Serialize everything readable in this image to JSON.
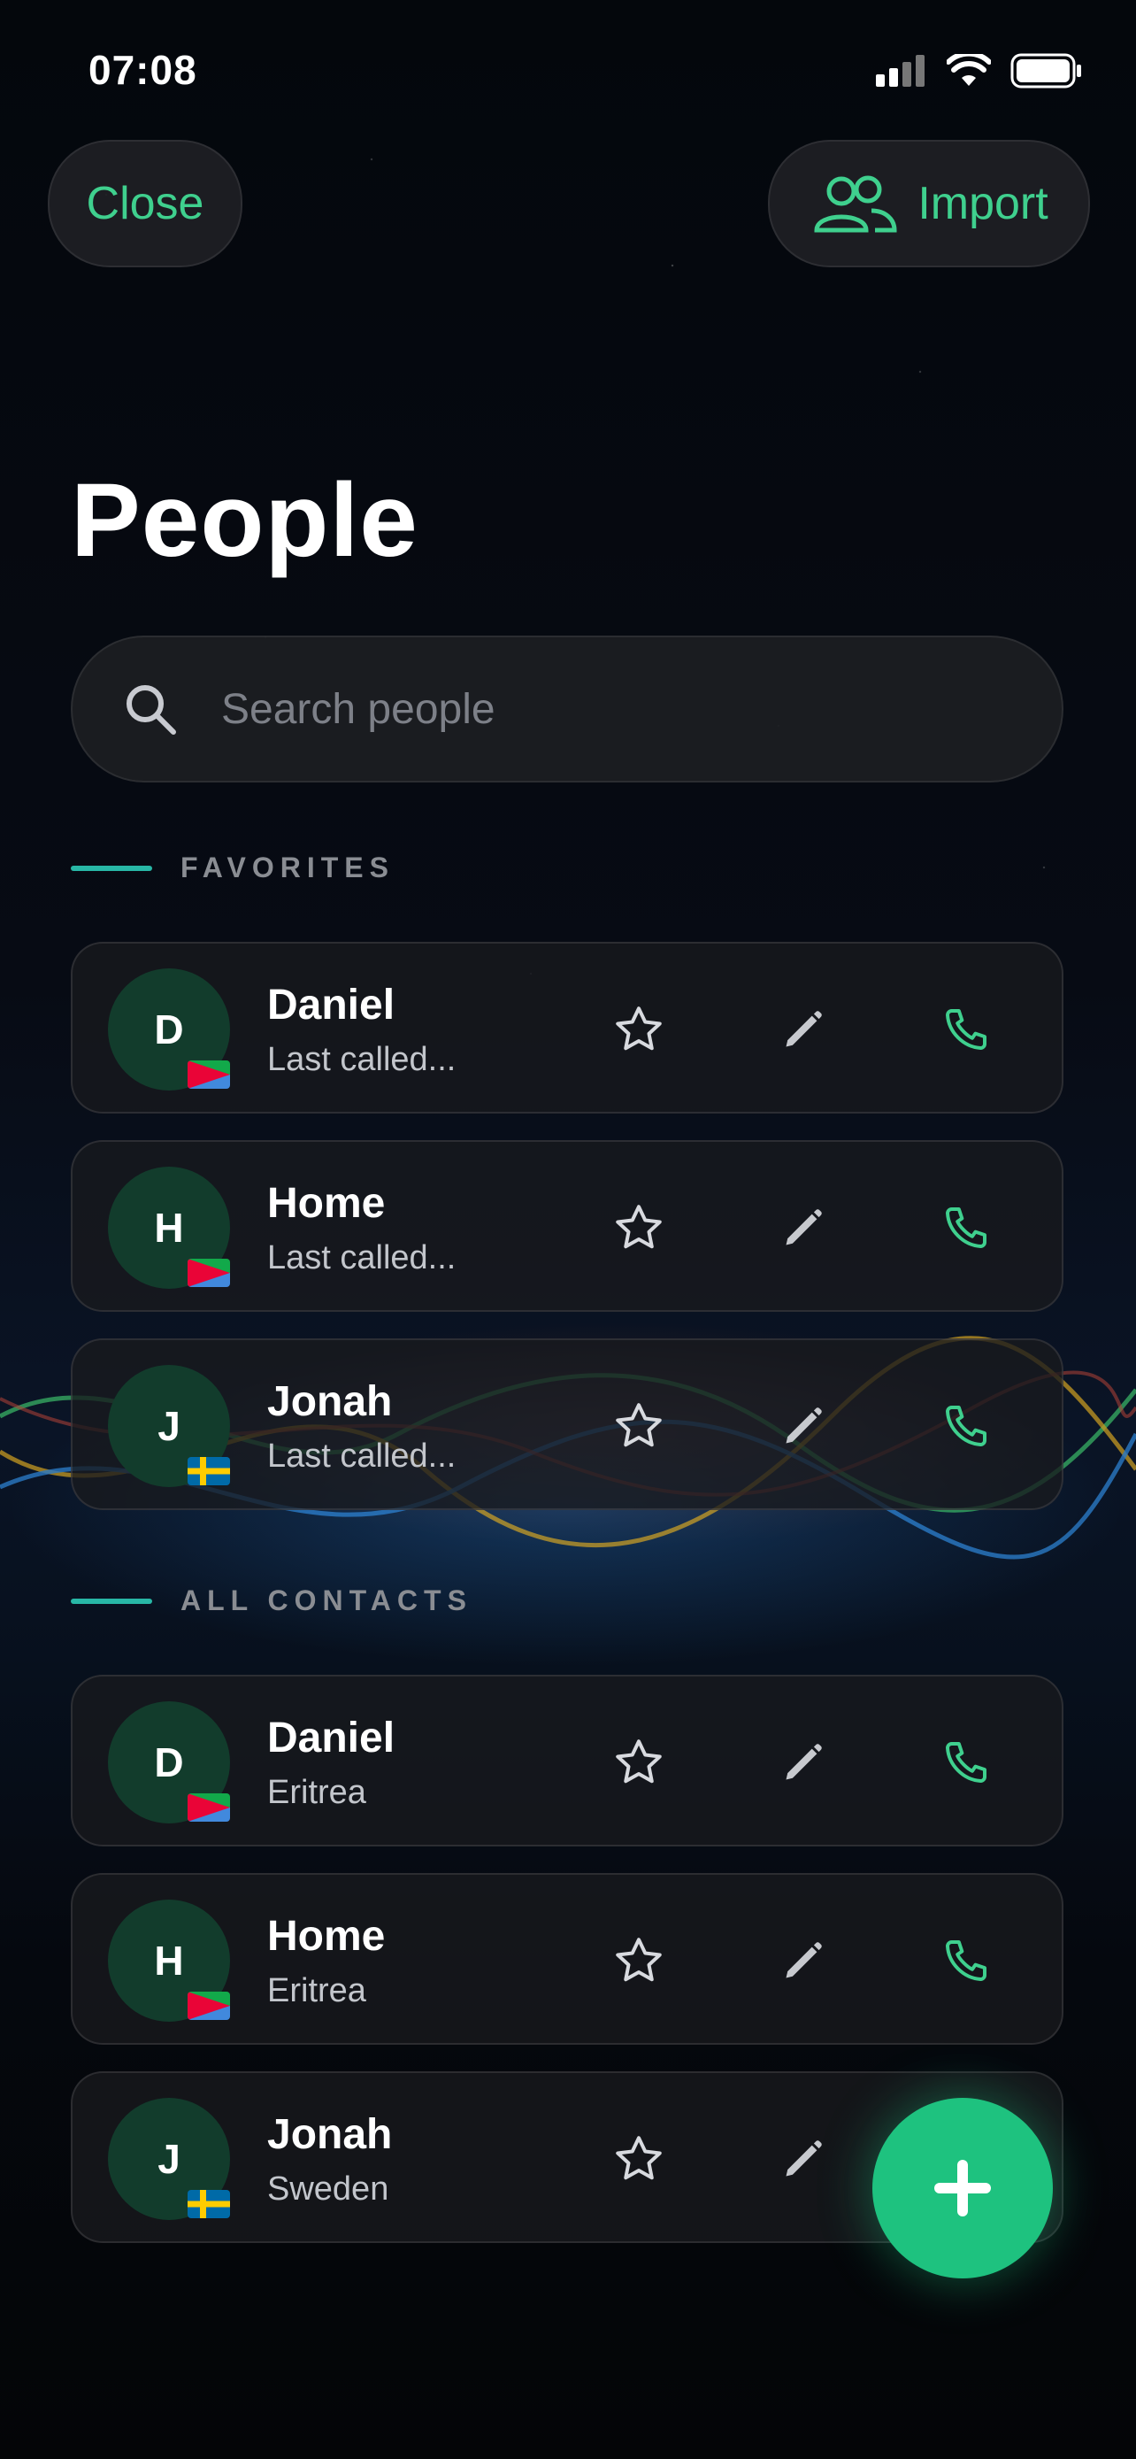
{
  "status_bar": {
    "time": "07:08"
  },
  "header": {
    "close_label": "Close",
    "import_label": "Import"
  },
  "page": {
    "title": "People"
  },
  "search": {
    "placeholder": "Search people"
  },
  "favorites": {
    "label": "FAVORITES",
    "items": [
      {
        "initial": "D",
        "name": "Daniel",
        "subtitle": "Last called...",
        "flag": "eritrea"
      },
      {
        "initial": "H",
        "name": "Home",
        "subtitle": "Last called...",
        "flag": "eritrea"
      },
      {
        "initial": "J",
        "name": "Jonah",
        "subtitle": "Last called...",
        "flag": "sweden"
      }
    ]
  },
  "all_contacts": {
    "label": "ALL CONTACTS",
    "items": [
      {
        "initial": "D",
        "name": "Daniel",
        "subtitle": "Eritrea",
        "flag": "eritrea"
      },
      {
        "initial": "H",
        "name": "Home",
        "subtitle": "Eritrea",
        "flag": "eritrea"
      },
      {
        "initial": "J",
        "name": "Jonah",
        "subtitle": "Sweden",
        "flag": "sweden"
      }
    ]
  },
  "icons": [
    "signal-icon",
    "wifi-icon",
    "battery-icon",
    "people-icon",
    "search-icon",
    "star-icon",
    "pencil-icon",
    "phone-icon",
    "plus-icon"
  ],
  "colors": {
    "accent": "#3fd08e",
    "fab": "#1ec27f",
    "avatar_bg": "#123c2c",
    "section_bar": "#28b7a6"
  }
}
